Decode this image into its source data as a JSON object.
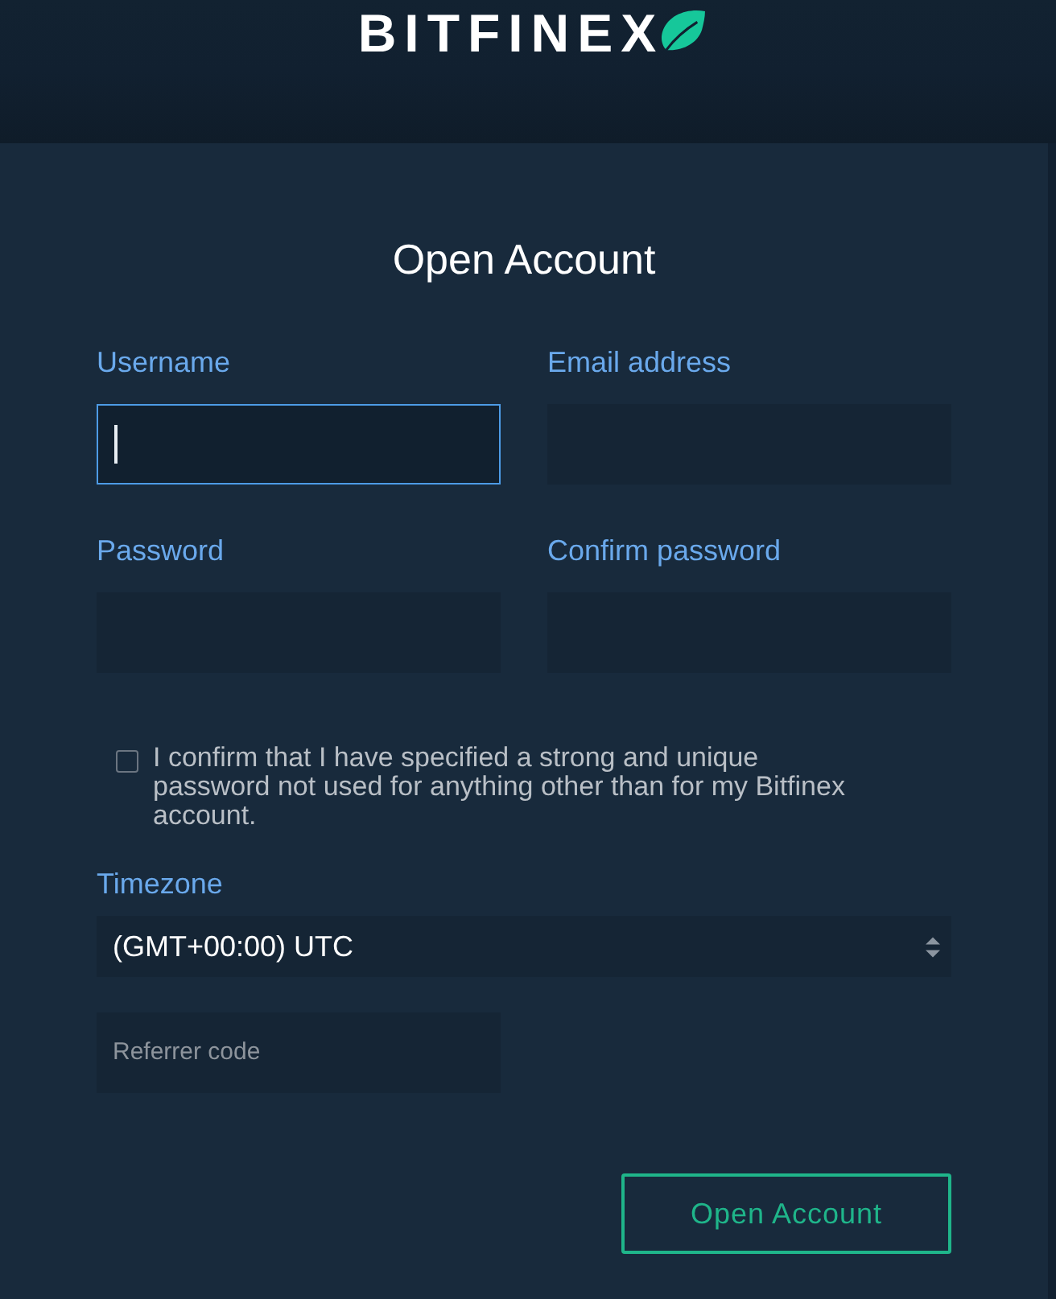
{
  "header": {
    "logo_text": "BITFINEX"
  },
  "form": {
    "title": "Open Account",
    "fields": [
      {
        "label": "Username",
        "focused": true
      },
      {
        "label": "Email address",
        "focused": false
      },
      {
        "label": "Password",
        "focused": false
      },
      {
        "label": "Confirm password",
        "focused": false
      }
    ],
    "confirm": {
      "checked": false,
      "text": "I confirm that I have specified a strong and unique password not used for anything other than for my Bitfinex account."
    },
    "timezone": {
      "label": "Timezone",
      "value": "(GMT+00:00) UTC"
    },
    "referrer": {
      "placeholder": "Referrer code"
    },
    "submit": "Open Account"
  }
}
